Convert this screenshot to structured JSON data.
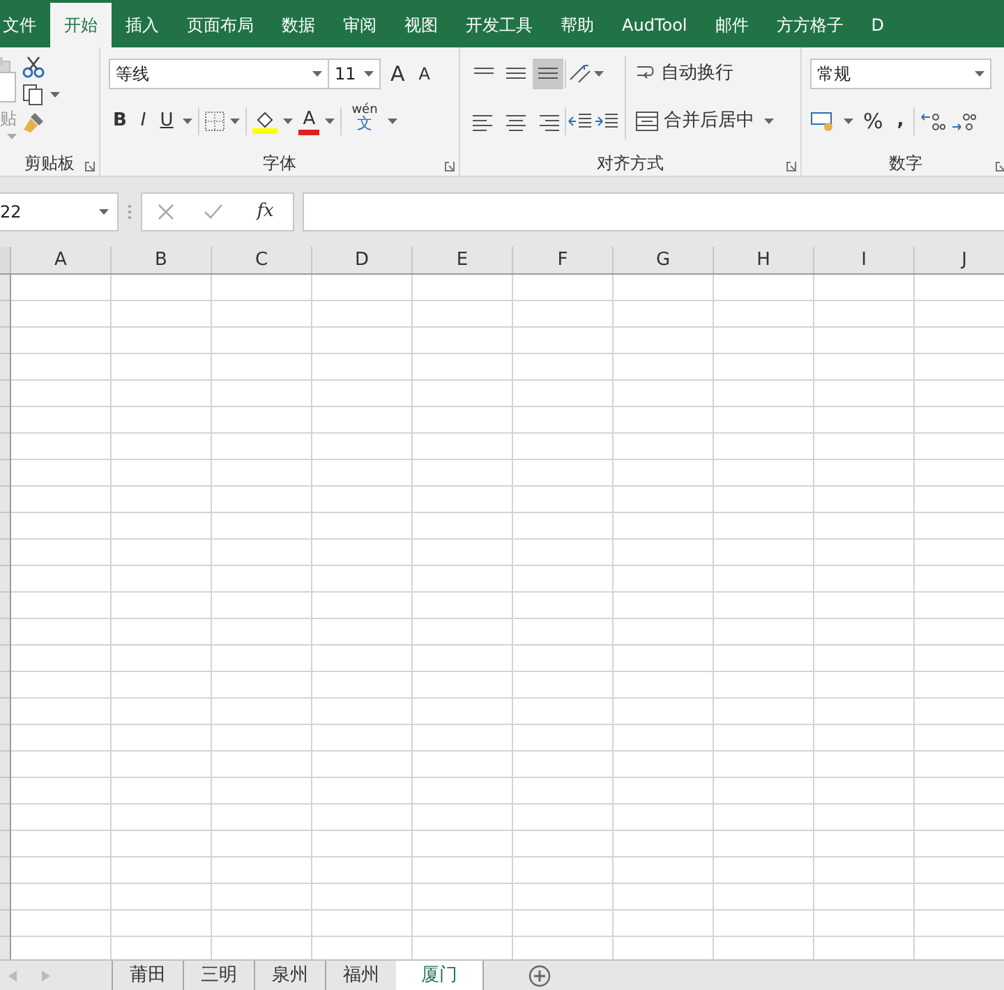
{
  "ribbon_tabs": [
    {
      "label": "文件",
      "selected": false
    },
    {
      "label": "开始",
      "selected": true
    },
    {
      "label": "插入",
      "selected": false
    },
    {
      "label": "页面布局",
      "selected": false
    },
    {
      "label": "数据",
      "selected": false
    },
    {
      "label": "审阅",
      "selected": false
    },
    {
      "label": "视图",
      "selected": false
    },
    {
      "label": "开发工具",
      "selected": false
    },
    {
      "label": "帮助",
      "selected": false
    },
    {
      "label": "AudTool",
      "selected": false
    },
    {
      "label": "邮件",
      "selected": false
    },
    {
      "label": "方方格子",
      "selected": false
    },
    {
      "label": "D",
      "selected": false
    }
  ],
  "clipboard": {
    "paste_label": "贴",
    "group_label": "剪贴板"
  },
  "font": {
    "font_name": "等线",
    "font_size": "11",
    "grow": "A",
    "shrink": "A",
    "styles": [
      "B",
      "I",
      "U"
    ],
    "font_color": "A",
    "phonetic_top": "wén",
    "phonetic_bottom": "文",
    "group_label": "字体"
  },
  "alignment": {
    "wrap_text": "自动换行",
    "merge_center": "合并后居中",
    "group_label": "对齐方式"
  },
  "number": {
    "format": "常规",
    "percent": "%",
    "comma": ",",
    "group_label": "数字"
  },
  "formula_bar": {
    "name_box": "22",
    "fx": "fx"
  },
  "columns": [
    "A",
    "B",
    "C",
    "D",
    "E",
    "F",
    "G",
    "H",
    "I",
    "J"
  ],
  "sheet_tabs": [
    {
      "label": "莆田",
      "selected": false
    },
    {
      "label": "三明",
      "selected": false
    },
    {
      "label": "泉州",
      "selected": false
    },
    {
      "label": "福州",
      "selected": false
    },
    {
      "label": "厦门",
      "selected": true
    }
  ]
}
